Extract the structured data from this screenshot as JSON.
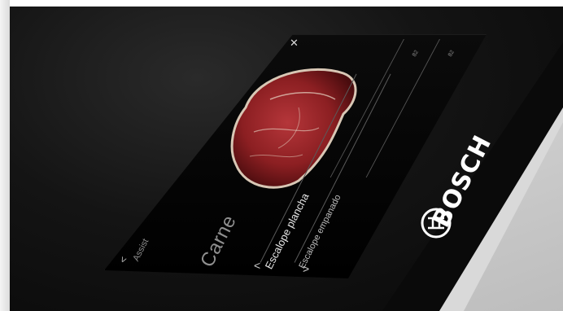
{
  "display": {
    "close_icon": "✕",
    "category": "Carne",
    "assist_label": "Assist",
    "nav_prev": "<",
    "programs": [
      {
        "label": "Escalope plancha",
        "selected": true
      },
      {
        "label": "Escalope empanado",
        "selected": false
      }
    ],
    "chevron_up": "<",
    "chevron_down": ">",
    "temp_labels": [
      "82",
      "82"
    ]
  },
  "brand": {
    "name": "BOSCH"
  },
  "colors": {
    "panel": "#000000",
    "meat": "#8c1f22",
    "cabinet": "#d9d9d9",
    "brand_text": "#ffffff"
  }
}
